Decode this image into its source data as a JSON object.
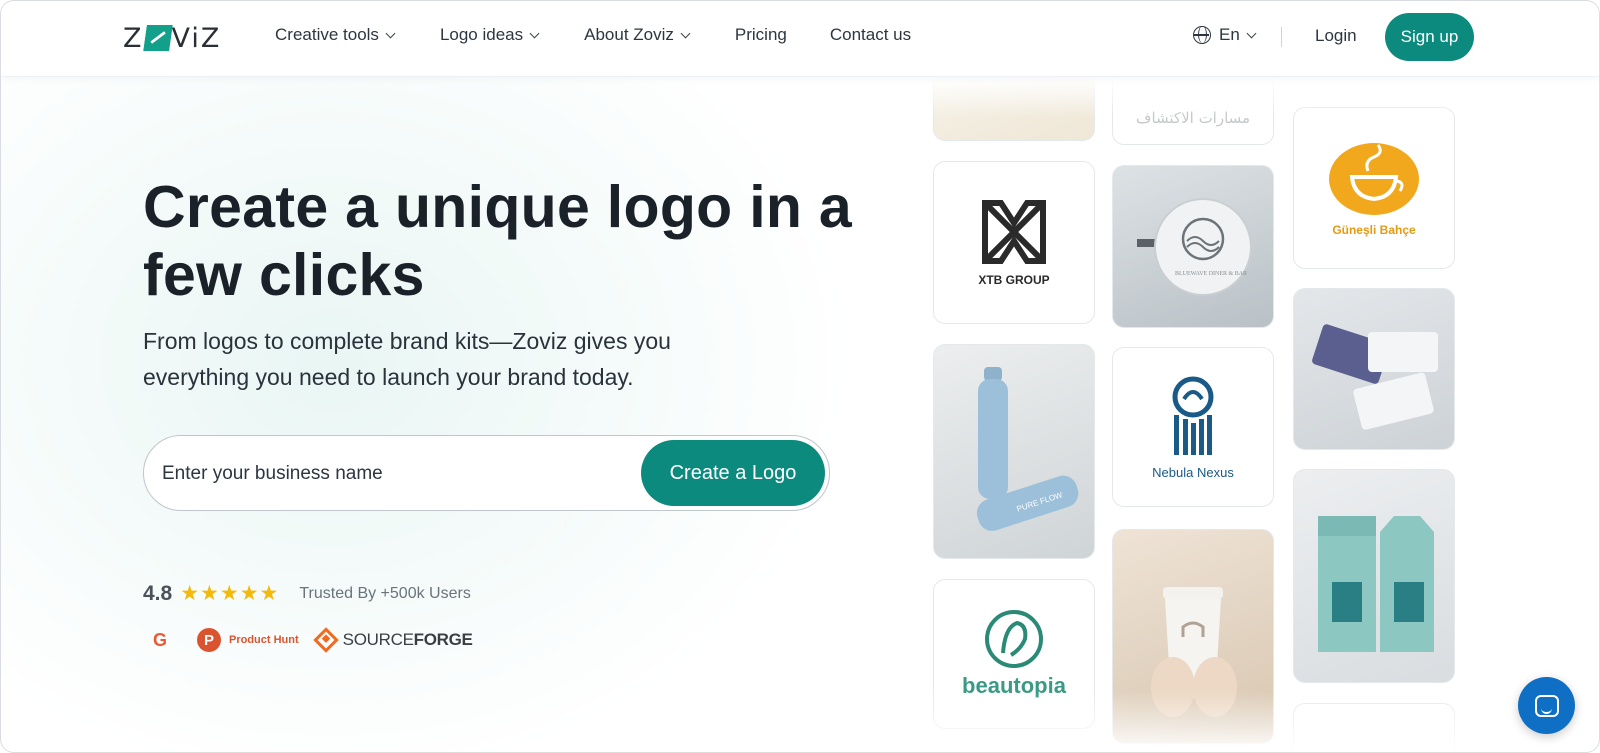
{
  "brand": {
    "logo_text_left": "Z",
    "logo_text_right": "ViZ"
  },
  "nav": {
    "items": [
      {
        "label": "Creative tools",
        "dropdown": true
      },
      {
        "label": "Logo ideas",
        "dropdown": true
      },
      {
        "label": "About Zoviz",
        "dropdown": true
      },
      {
        "label": "Pricing",
        "dropdown": false
      },
      {
        "label": "Contact us",
        "dropdown": false
      }
    ],
    "language": "En",
    "login": "Login",
    "signup": "Sign up"
  },
  "hero": {
    "title": "Create a unique logo in a few clicks",
    "subtitle": "From logos to complete brand kits—Zoviz gives you everything you need to launch your brand today.",
    "input_placeholder": "Enter your business name",
    "cta": "Create a Logo"
  },
  "rating": {
    "score": "4.8",
    "stars": 5,
    "trusted": "Trusted By +500k Users"
  },
  "badges": {
    "g2": "G",
    "product_hunt_letter": "P",
    "product_hunt": "Product Hunt",
    "sourceforge_light": "SOURCE",
    "sourceforge_bold": "FORGE"
  },
  "gallery": {
    "xtb": "XTB GROUP",
    "gunesli": "Güneşli Bahçe",
    "nebula": "Nebula Nexus",
    "beautopia": "beautopia",
    "arabic": "مسارات الاكتشاف",
    "pure_flow": "PURE FLOW",
    "bluewave": "BLUEWAVE DINER & BAR"
  },
  "colors": {
    "accent": "#0d8a7e",
    "star": "#f4b90d",
    "chat": "#0f6fc4"
  }
}
